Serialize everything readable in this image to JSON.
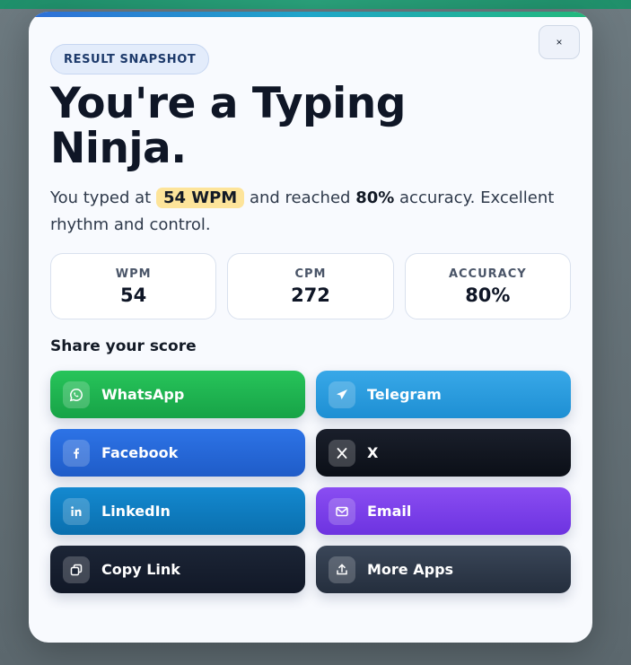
{
  "modal": {
    "badge": "RESULT SNAPSHOT",
    "close_label": "×",
    "title": "You're a Typing Ninja.",
    "summary": {
      "prefix": "You typed at",
      "wpm_highlight": "54 WPM",
      "middle": "and reached",
      "accuracy_highlight": "80%",
      "suffix": "accuracy. Excellent rhythm and control."
    },
    "stats": [
      {
        "label": "WPM",
        "value": "54"
      },
      {
        "label": "CPM",
        "value": "272"
      },
      {
        "label": "ACCURACY",
        "value": "80%"
      }
    ],
    "share_heading": "Share your score",
    "share_buttons": [
      {
        "label": "WhatsApp",
        "icon": "whatsapp-icon",
        "color": "#1fb350"
      },
      {
        "label": "Telegram",
        "icon": "telegram-icon",
        "color": "#2a9be0"
      },
      {
        "label": "Facebook",
        "icon": "facebook-icon",
        "color": "#2566d8"
      },
      {
        "label": "X",
        "icon": "x-icon",
        "color": "#111722"
      },
      {
        "label": "LinkedIn",
        "icon": "linkedin-icon",
        "color": "#0f7cc0"
      },
      {
        "label": "Email",
        "icon": "email-icon",
        "color": "#7b40ea"
      },
      {
        "label": "Copy Link",
        "icon": "copy-link-icon",
        "color": "#161f2f"
      },
      {
        "label": "More Apps",
        "icon": "share-upload-icon",
        "color": "#2f3a4a"
      }
    ]
  },
  "colors": {
    "accent_gradient_start": "#2f6fd8",
    "accent_gradient_end": "#22b87a",
    "highlight": "#fde49a",
    "title": "#0f1626"
  }
}
